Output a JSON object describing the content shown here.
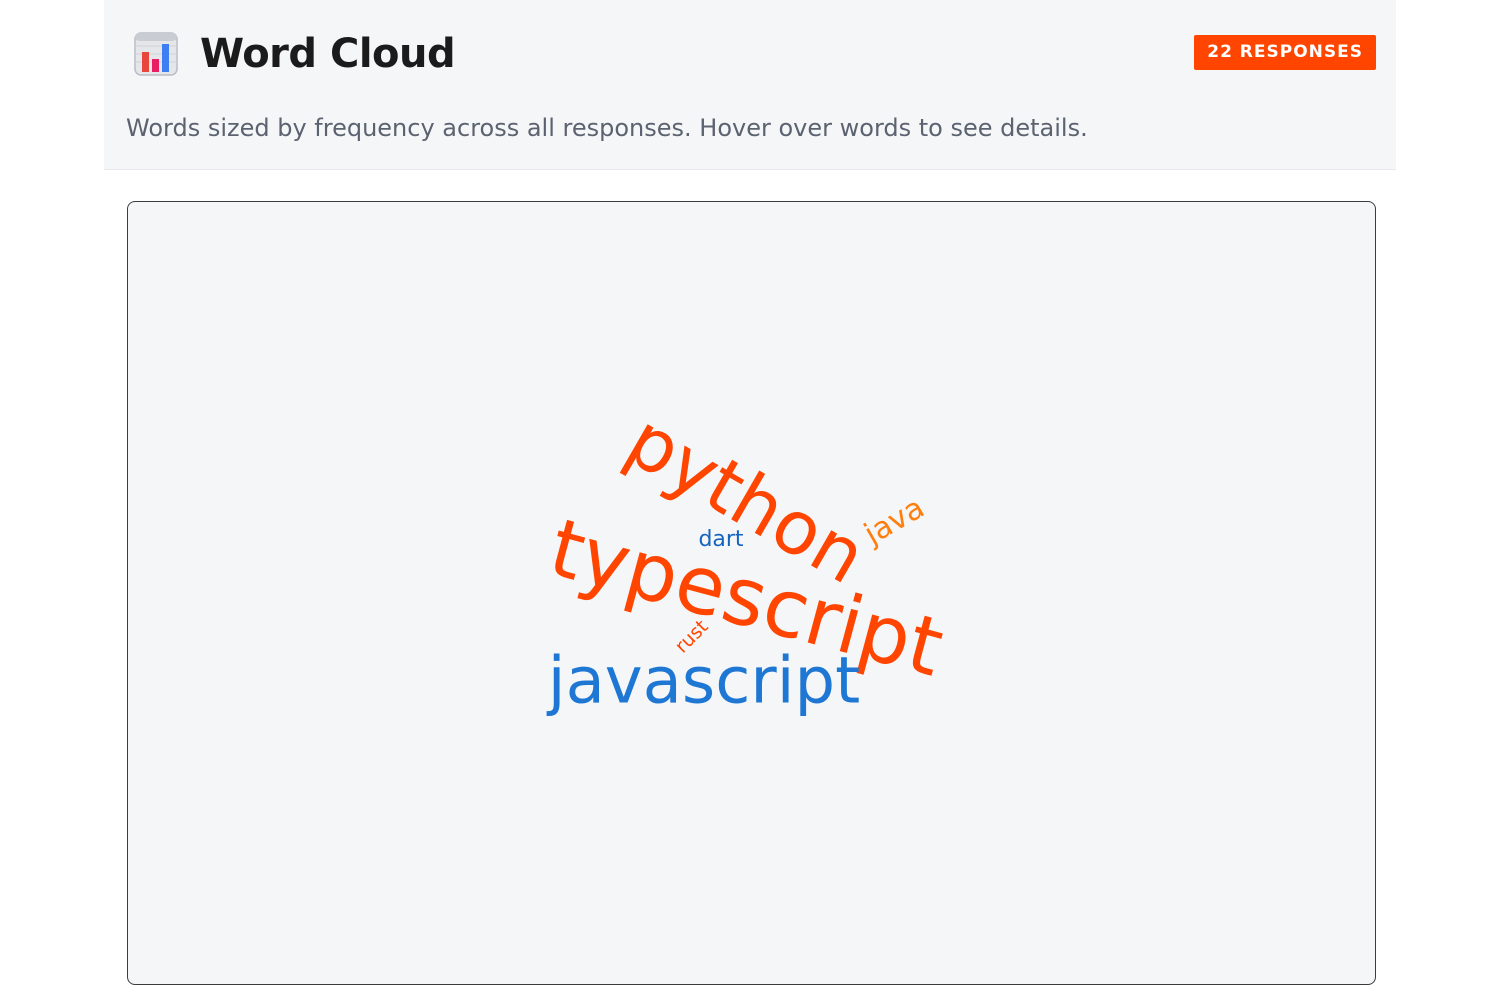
{
  "header": {
    "icon": "bar-chart-icon",
    "title": "Word Cloud",
    "badge": "22 RESPONSES",
    "description": "Words sized by frequency across all responses. Hover over words to see details."
  },
  "colors": {
    "accent": "#ff4500",
    "orange": "#ff7f0e",
    "blue": "#1f77d4",
    "dark_blue": "#1565c0",
    "panel_bg": "#f5f6f8",
    "text_muted": "#5c6370"
  },
  "chart_data": {
    "type": "wordcloud",
    "words": [
      {
        "text": "python",
        "color": "#ff4500",
        "rotation": 30
      },
      {
        "text": "typescript",
        "color": "#ff4500",
        "rotation": 15
      },
      {
        "text": "javascript",
        "color": "#1f77d4",
        "rotation": 0
      },
      {
        "text": "java",
        "color": "#ff7f0e",
        "rotation": -30
      },
      {
        "text": "dart",
        "color": "#1565c0",
        "rotation": 0
      },
      {
        "text": "rust",
        "color": "#ff4500",
        "rotation": -45
      }
    ]
  }
}
